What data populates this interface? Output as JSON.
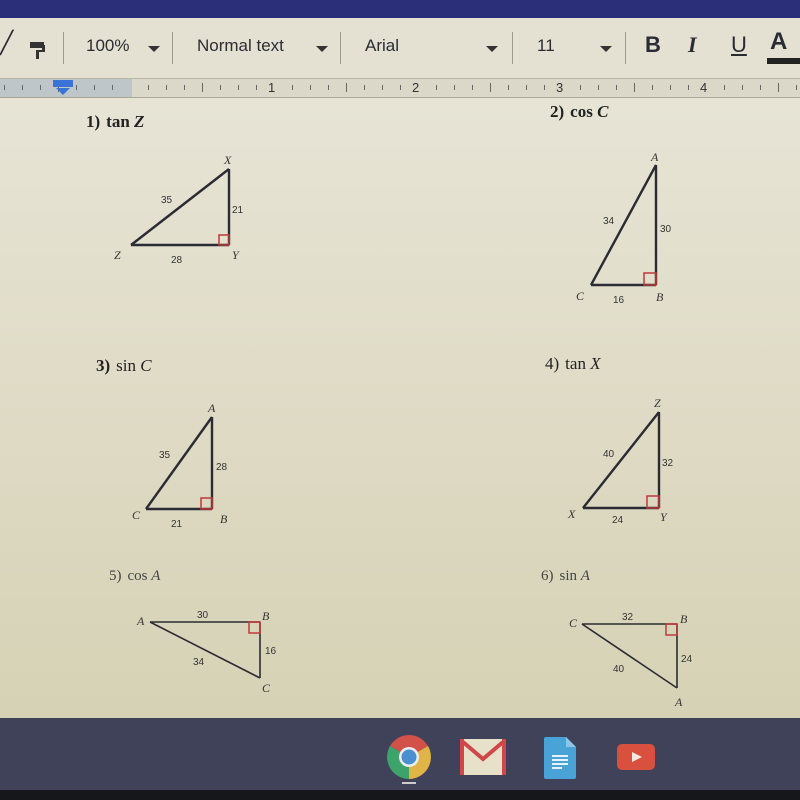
{
  "toolbar": {
    "zoom": "100%",
    "style": "Normal text",
    "font": "Arial",
    "font_size": "11",
    "bold": "B",
    "italic": "I",
    "underline": "U",
    "text_color": "A"
  },
  "ruler": {
    "numbers": [
      "1",
      "2",
      "3",
      "4"
    ]
  },
  "problems": [
    {
      "number": "1)",
      "function": "tan",
      "angle": "Z",
      "vertices": {
        "top": "X",
        "left": "Z",
        "right": "Y"
      },
      "sides": {
        "hypotenuse": "35",
        "vertical": "21",
        "horizontal": "28"
      }
    },
    {
      "number": "2)",
      "function": "cos",
      "angle": "C",
      "vertices": {
        "top": "A",
        "left": "C",
        "right": "B"
      },
      "sides": {
        "hypotenuse": "34",
        "vertical": "30",
        "horizontal": "16"
      }
    },
    {
      "number": "3)",
      "function": "sin",
      "angle": "C",
      "vertices": {
        "top": "A",
        "left": "C",
        "right": "B"
      },
      "sides": {
        "hypotenuse": "35",
        "vertical": "28",
        "horizontal": "21"
      }
    },
    {
      "number": "4)",
      "function": "tan",
      "angle": "X",
      "vertices": {
        "top": "Z",
        "left": "X",
        "right": "Y"
      },
      "sides": {
        "hypotenuse": "40",
        "vertical": "32",
        "horizontal": "24"
      }
    },
    {
      "number": "5)",
      "function": "cos",
      "angle": "A",
      "vertices": {
        "left": "A",
        "corner": "B",
        "bottom": "C"
      },
      "sides": {
        "top": "30",
        "vertical": "16",
        "hypotenuse": "34"
      }
    },
    {
      "number": "6)",
      "function": "sin",
      "angle": "A",
      "vertices": {
        "left": "C",
        "corner": "B",
        "bottom": "A"
      },
      "sides": {
        "top": "32",
        "vertical": "24",
        "hypotenuse": "40"
      }
    }
  ],
  "shelf": {
    "apps": [
      {
        "name": "Chrome",
        "icon": "chrome-icon"
      },
      {
        "name": "Gmail",
        "icon": "gmail-icon"
      },
      {
        "name": "Docs",
        "icon": "docs-icon"
      },
      {
        "name": "YouTube",
        "icon": "youtube-icon"
      }
    ]
  },
  "colors": {
    "right_angle": "#c0393a",
    "page": "#e5e2d3",
    "shelf": "#3f4258"
  }
}
